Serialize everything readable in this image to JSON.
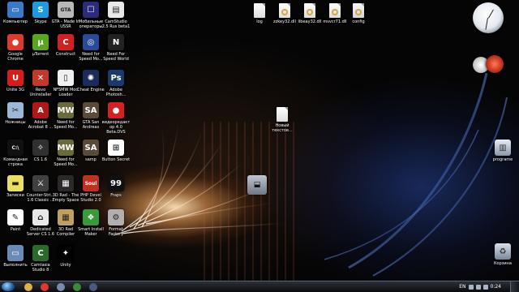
{
  "desktop_icons": [
    {
      "label": "Компьютер",
      "icon": "computer-icon",
      "color": "#3a78c8",
      "glyph": "▭"
    },
    {
      "label": "Skype",
      "icon": "skype-icon",
      "color": "#1e9be0",
      "glyph": "S"
    },
    {
      "label": "GTA - Made In USSR",
      "icon": "gta-icon",
      "color": "#b8b8b8",
      "glyph": "GTA"
    },
    {
      "label": "Мобильные операторы",
      "icon": "mobile-operators-icon",
      "color": "#2c2c7a",
      "glyph": "☐"
    },
    {
      "label": "CamStudio 2.5 Rus beta1",
      "icon": "camstudio-icon",
      "color": "#e8e8e8",
      "glyph": "▤"
    },
    {
      "label": "Google Chrome",
      "icon": "chrome-icon",
      "color": "#dd3a2e",
      "glyph": "●"
    },
    {
      "label": "µTorrent",
      "icon": "utorrent-icon",
      "color": "#5aa620",
      "glyph": "µ"
    },
    {
      "label": "Construct",
      "icon": "construct-icon",
      "color": "#d02020",
      "glyph": "C"
    },
    {
      "label": "Need for Speed Mo...",
      "icon": "bmw-icon",
      "color": "#2a4a9a",
      "glyph": "◎"
    },
    {
      "label": "Need For Speed World",
      "icon": "nfs-world-icon",
      "color": "#222222",
      "glyph": "N"
    },
    {
      "label": "Unite 3G",
      "icon": "unite3g-icon",
      "color": "#d81c1c",
      "glyph": "U"
    },
    {
      "label": "Revo Uninstaller",
      "icon": "revo-icon",
      "color": "#c0392b",
      "glyph": "✕"
    },
    {
      "label": "NFSMW Mod Loader",
      "icon": "nfsmw-loader-icon",
      "color": "#f0f0f0",
      "glyph": "▯"
    },
    {
      "label": "Cheat Engine",
      "icon": "cheat-engine-icon",
      "color": "#1c2c5a",
      "glyph": "✺"
    },
    {
      "label": "Adobe Photosh...",
      "icon": "photoshop-icon",
      "color": "#1a3a6e",
      "glyph": "Ps"
    },
    {
      "label": "Ножницы",
      "icon": "snipping-tool-icon",
      "color": "#9bb8d8",
      "glyph": "✂"
    },
    {
      "label": "Adobe Acrobat 8 ...",
      "icon": "acrobat-icon",
      "color": "#b01818",
      "glyph": "A"
    },
    {
      "label": "Need for Speed Mo...",
      "icon": "nfs-mw-icon",
      "color": "#6a6a3a",
      "glyph": "MW"
    },
    {
      "label": "GTA San Andreas",
      "icon": "gta-sa-icon",
      "color": "#5a4a3a",
      "glyph": "SA"
    },
    {
      "label": "видеоредактор 4.0 Beta.DVS",
      "icon": "angry-birds-icon",
      "color": "#d32020",
      "glyph": "●"
    },
    {
      "label": "Командная строка",
      "icon": "cmd-icon",
      "color": "#111111",
      "glyph": "C:\\"
    },
    {
      "label": "CS 1.6",
      "icon": "cs16-icon",
      "color": "#303030",
      "glyph": "✧"
    },
    {
      "label": "Need for Speed Mo...",
      "icon": "nfs-mw2-icon",
      "color": "#6a6a3a",
      "glyph": "MW"
    },
    {
      "label": "samp",
      "icon": "samp-icon",
      "color": "#5a4a3a",
      "glyph": "SA"
    },
    {
      "label": "Button Secret",
      "icon": "windows-logo-icon",
      "color": "#ffffff",
      "glyph": "⊞"
    },
    {
      "label": "Записки",
      "icon": "sticky-notes-icon",
      "color": "#e8e060",
      "glyph": "▬"
    },
    {
      "label": "Counter-Stri... 1.6 Classic ...",
      "icon": "counter-strike-icon",
      "color": "#404040",
      "glyph": "⚔"
    },
    {
      "label": "3D Rad - The Empty Space",
      "icon": "3drad-icon",
      "color": "#2a2a2a",
      "glyph": "▦"
    },
    {
      "label": "PHP Devel Studio 2.0",
      "icon": "php-devel-icon",
      "color": "#c03020",
      "glyph": "Soul"
    },
    {
      "label": "Fraps",
      "icon": "fraps-icon",
      "color": "#101010",
      "glyph": "99"
    },
    {
      "label": "Paint",
      "icon": "paint-icon",
      "color": "#ffffff",
      "glyph": "✎"
    },
    {
      "label": "Dedicated Server CS 1.6",
      "icon": "dedicated-server-icon",
      "color": "#e8e8e8",
      "glyph": "⌂"
    },
    {
      "label": "3D Rad Compiler",
      "icon": "3drad-compiler-icon",
      "color": "#c0a060",
      "glyph": "▦"
    },
    {
      "label": "Smart Install Maker",
      "icon": "smart-install-icon",
      "color": "#3a9a3a",
      "glyph": "❖"
    },
    {
      "label": "Format Factory",
      "icon": "format-factory-icon",
      "color": "#b0b0b0",
      "glyph": "⚙"
    },
    {
      "label": "Выполнить",
      "icon": "run-icon",
      "color": "#6a8ab8",
      "glyph": "▭"
    },
    {
      "label": "Camtasia Studio 8",
      "icon": "camtasia-icon",
      "color": "#2a6a2a",
      "glyph": "C"
    },
    {
      "label": "Unity",
      "icon": "unity-icon",
      "color": "#000000",
      "glyph": "✦"
    }
  ],
  "file_icons": [
    {
      "label": "log",
      "icon": "log-file-icon",
      "kind": "plain"
    },
    {
      "label": "zzkey32.dll",
      "icon": "dll-file-icon",
      "kind": "dll"
    },
    {
      "label": "libeay32.dll",
      "icon": "dll-file-icon",
      "kind": "dll"
    },
    {
      "label": "msvcr71.dll",
      "icon": "dll-file-icon",
      "kind": "dll"
    },
    {
      "label": "config",
      "icon": "config-file-icon",
      "kind": "cfg"
    }
  ],
  "center_file": {
    "label": "Новый текстов...",
    "icon": "text-document-icon"
  },
  "right_icons": [
    {
      "label": "programe",
      "icon": "folder-icon"
    },
    {
      "label": "Корзина",
      "icon": "recycle-bin-icon"
    }
  ],
  "taskbar": {
    "pinned": [
      {
        "name": "taskbar-folder",
        "icon": "folder-icon",
        "color": "#e0b040"
      },
      {
        "name": "taskbar-chrome",
        "icon": "chrome-icon",
        "color": "#dd3a2e"
      },
      {
        "name": "taskbar-app-1",
        "icon": "window-icon",
        "color": "#7a8aa8"
      },
      {
        "name": "taskbar-app-2",
        "icon": "camtasia-icon",
        "color": "#3a8a3a"
      },
      {
        "name": "taskbar-app-3",
        "icon": "app-icon",
        "color": "#4a5a7a"
      }
    ],
    "language": "EN",
    "time": "0:24"
  }
}
